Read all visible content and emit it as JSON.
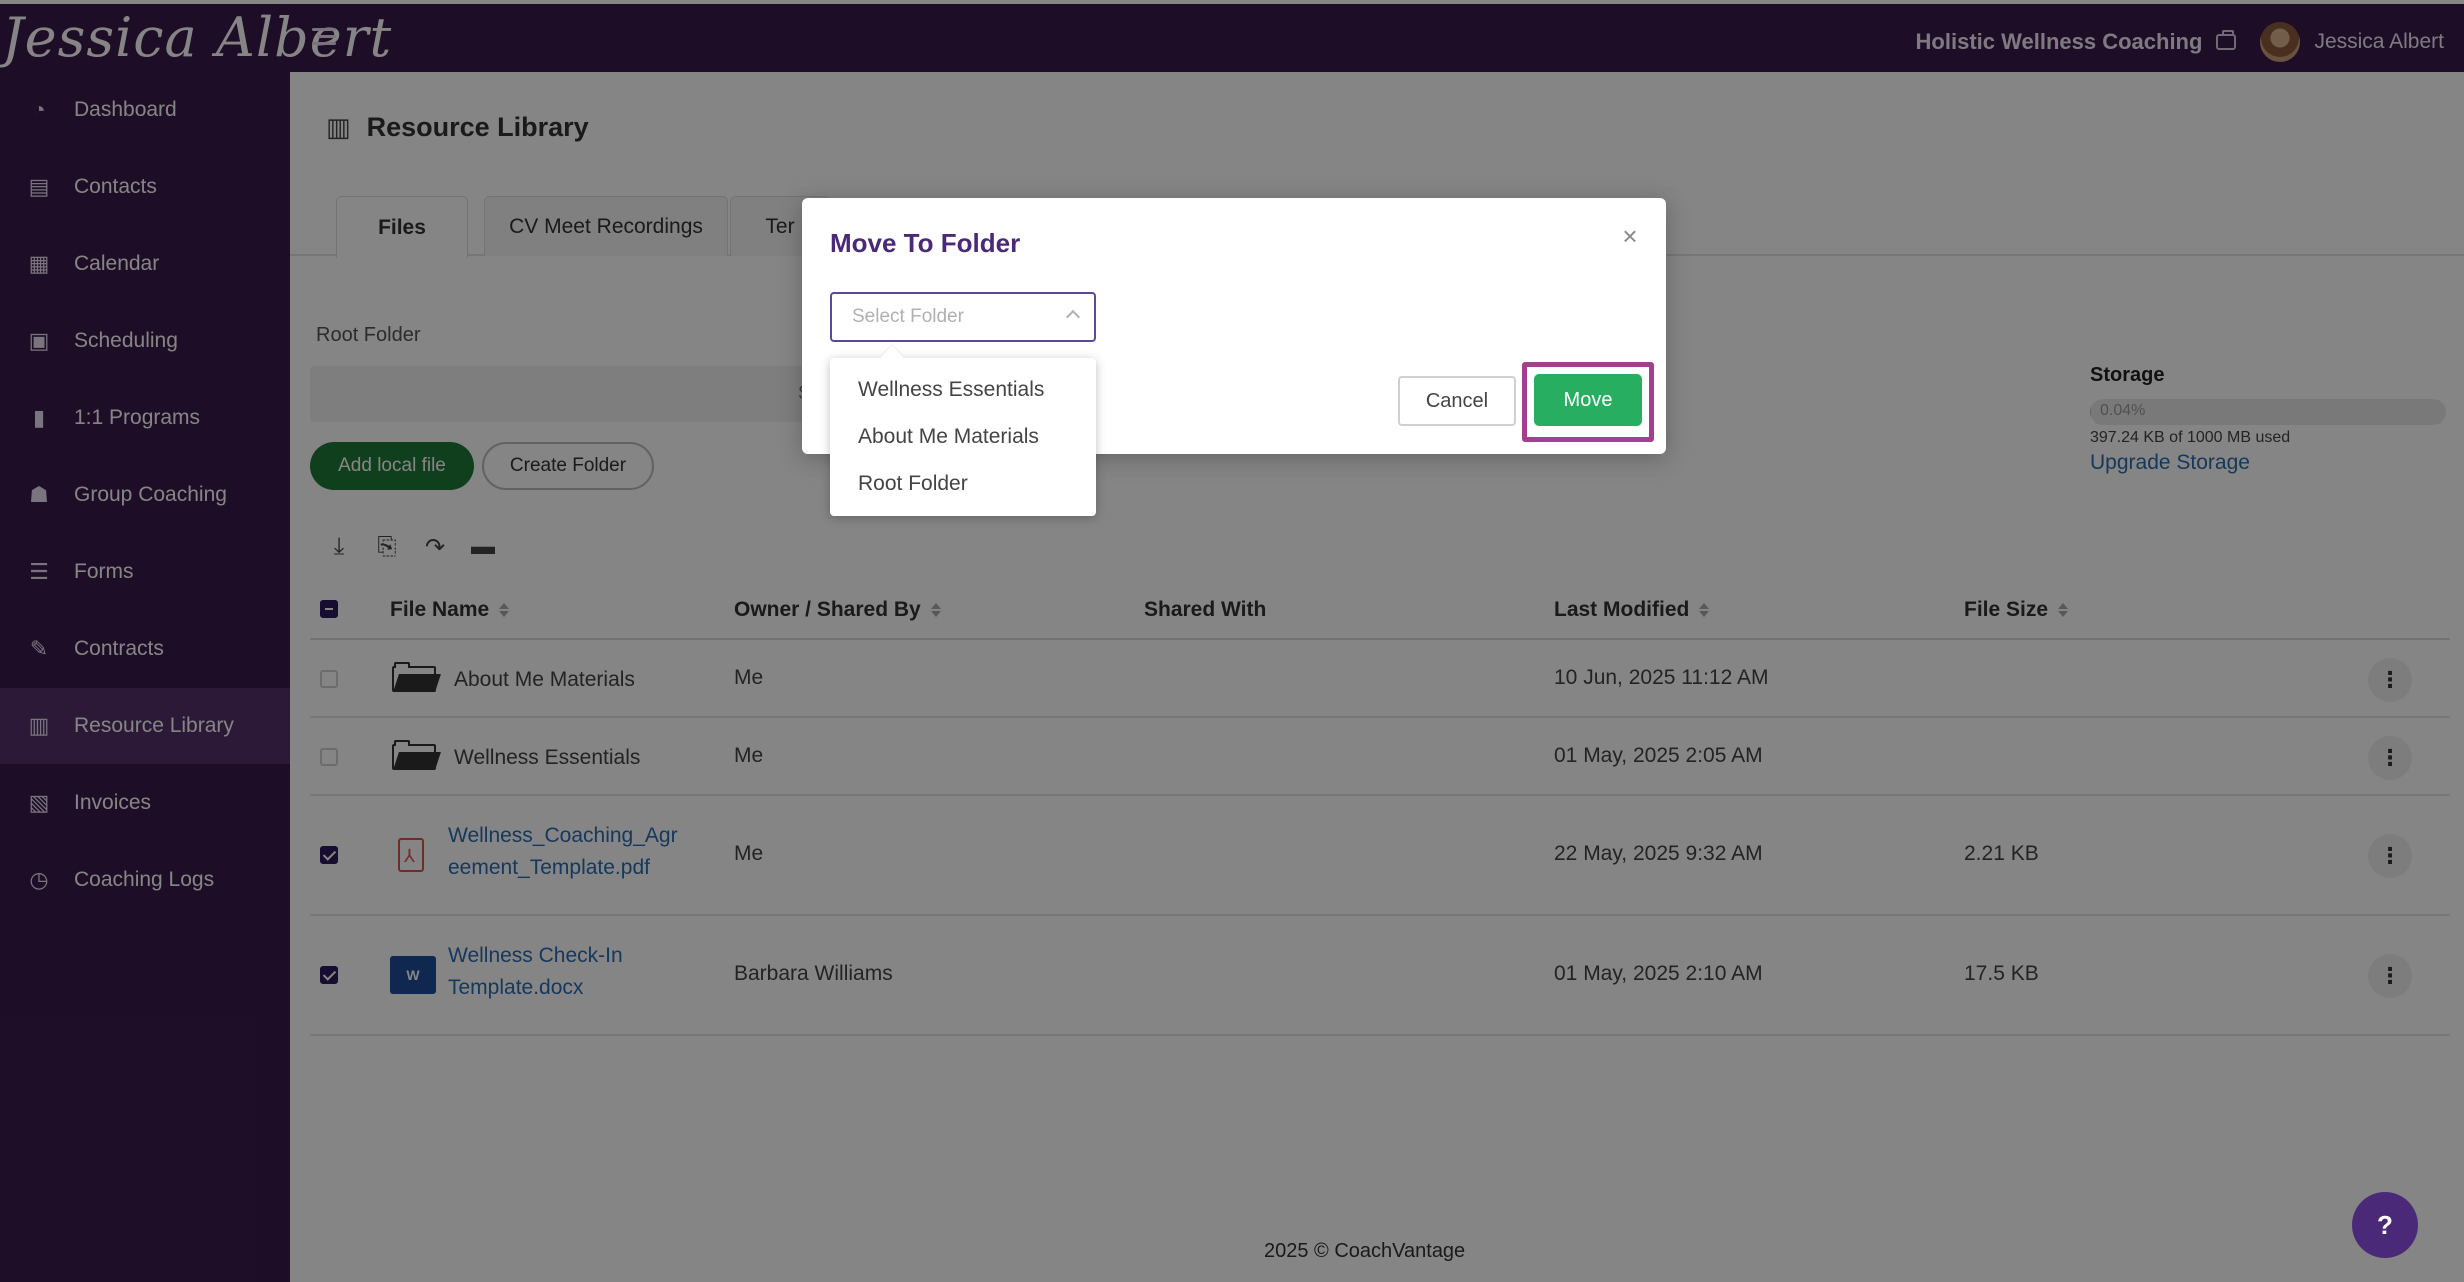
{
  "header": {
    "logo_text": "Jessica Albert",
    "business_name": "Holistic Wellness Coaching",
    "user_name": "Jessica Albert"
  },
  "sidebar": {
    "items": [
      {
        "label": "Dashboard",
        "icon": "dashboard-icon"
      },
      {
        "label": "Contacts",
        "icon": "contacts-icon"
      },
      {
        "label": "Calendar",
        "icon": "calendar-icon"
      },
      {
        "label": "Scheduling",
        "icon": "scheduling-icon"
      },
      {
        "label": "1:1 Programs",
        "icon": "book-icon"
      },
      {
        "label": "Group Coaching",
        "icon": "group-icon"
      },
      {
        "label": "Forms",
        "icon": "forms-icon"
      },
      {
        "label": "Contracts",
        "icon": "contract-icon"
      },
      {
        "label": "Resource Library",
        "icon": "library-icon",
        "active": true
      },
      {
        "label": "Invoices",
        "icon": "invoice-icon"
      },
      {
        "label": "Coaching Logs",
        "icon": "clock-icon"
      }
    ]
  },
  "page": {
    "title": "Resource Library",
    "tabs": [
      {
        "label": "Files",
        "active": true
      },
      {
        "label": "CV Meet Recordings"
      },
      {
        "label": "Ter"
      }
    ],
    "breadcrumb": "Root Folder",
    "search_placeholder": "Search by File Name, Owner",
    "add_local_file_label": "Add local file",
    "create_folder_label": "Create Folder"
  },
  "storage": {
    "title": "Storage",
    "percent_label": "0.04%",
    "percent_value": 0.04,
    "used_text": "397.24 KB of 1000 MB used",
    "upgrade_label": "Upgrade Storage"
  },
  "table": {
    "headers": {
      "file_name": "File Name",
      "owner": "Owner / Shared By",
      "shared_with": "Shared With",
      "last_modified": "Last Modified",
      "file_size": "File Size"
    },
    "rows": [
      {
        "type": "folder",
        "name": "About Me Materials",
        "owner": "Me",
        "shared_with": "",
        "modified": "10 Jun, 2025 11:12 AM",
        "size": "",
        "checked": false
      },
      {
        "type": "folder",
        "name": "Wellness Essentials",
        "owner": "Me",
        "shared_with": "",
        "modified": "01 May, 2025 2:05 AM",
        "size": "",
        "checked": false
      },
      {
        "type": "pdf",
        "name_line1": "Wellness_Coaching_Agr",
        "name_line2": "eement_Template.pdf",
        "owner": "Me",
        "shared_with": "",
        "modified": "22 May, 2025 9:32 AM",
        "size": "2.21 KB",
        "checked": true
      },
      {
        "type": "docx",
        "name_line1": "Wellness Check-In",
        "name_line2": "Template.docx",
        "owner": "Barbara Williams",
        "shared_with": "",
        "modified": "01 May, 2025 2:10 AM",
        "size": "17.5 KB",
        "checked": true
      }
    ]
  },
  "footer": {
    "text": "2025 © CoachVantage"
  },
  "modal": {
    "title": "Move To Folder",
    "select_placeholder": "Select Folder",
    "options": [
      "Wellness Essentials",
      "About Me Materials",
      "Root Folder"
    ],
    "cancel_label": "Cancel",
    "move_label": "Move"
  },
  "help": {
    "label": "?"
  },
  "colors": {
    "sidebar_bg": "#3b1a4b",
    "accent_purple": "#4a2a78",
    "move_green": "#27ae60",
    "add_green": "#1f7a3a",
    "link_blue": "#2b6cb0",
    "highlight_magenta": "#a0408e"
  }
}
